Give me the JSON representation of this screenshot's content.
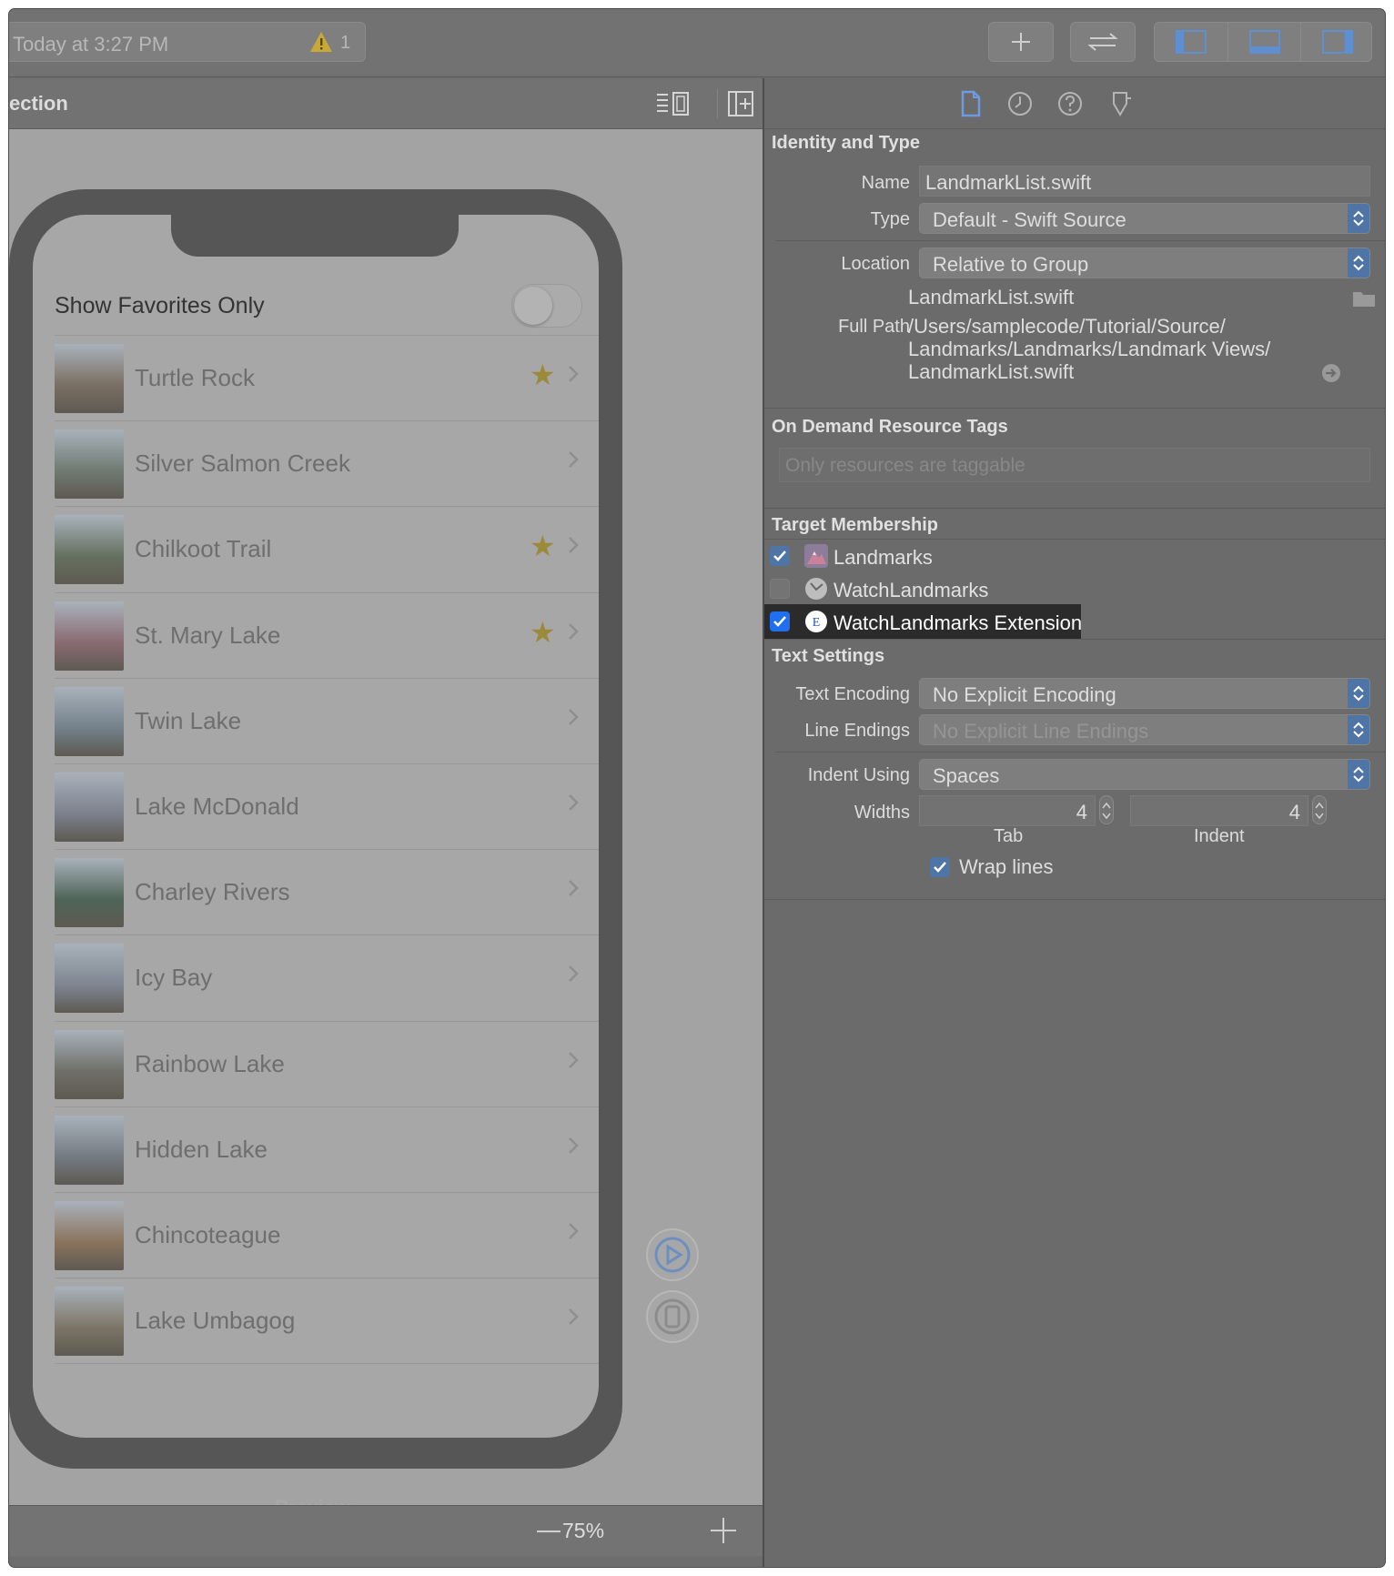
{
  "toolbar": {
    "status_text": "Today at 3:27 PM",
    "warning_count": "1",
    "icons": [
      "add-icon",
      "swap-icon",
      "navigator-panel-icon",
      "debug-panel-icon",
      "inspector-panel-icon"
    ]
  },
  "editor": {
    "title": "ection",
    "header_icons": [
      "editor-options-icon",
      "add-editor-icon"
    ]
  },
  "preview": {
    "favorites_label": "Show Favorites Only",
    "favorites_toggle": false,
    "landmarks": [
      {
        "name": "Turtle Rock",
        "favorite": true,
        "thumb_color": "#7a6f63"
      },
      {
        "name": "Silver Salmon Creek",
        "favorite": false,
        "thumb_color": "#6f7a72"
      },
      {
        "name": "Chilkoot Trail",
        "favorite": true,
        "thumb_color": "#65705f"
      },
      {
        "name": "St. Mary Lake",
        "favorite": true,
        "thumb_color": "#8a6a72"
      },
      {
        "name": "Twin Lake",
        "favorite": false,
        "thumb_color": "#73808a"
      },
      {
        "name": "Lake McDonald",
        "favorite": false,
        "thumb_color": "#7c808c"
      },
      {
        "name": "Charley Rivers",
        "favorite": false,
        "thumb_color": "#4f6458"
      },
      {
        "name": "Icy Bay",
        "favorite": false,
        "thumb_color": "#7e8590"
      },
      {
        "name": "Rainbow Lake",
        "favorite": false,
        "thumb_color": "#6e6f68"
      },
      {
        "name": "Hidden Lake",
        "favorite": false,
        "thumb_color": "#747a82"
      },
      {
        "name": "Chincoteague",
        "favorite": false,
        "thumb_color": "#8a735c"
      },
      {
        "name": "Lake Umbagog",
        "favorite": false,
        "thumb_color": "#7c7566"
      }
    ],
    "label": "Preview",
    "zoom": "75%"
  },
  "inspector": {
    "tabs": [
      "file-inspector-icon",
      "history-icon",
      "quick-help-icon",
      "accessibility-icon"
    ],
    "identity": {
      "title": "Identity and Type",
      "name_label": "Name",
      "name_value": "LandmarkList.swift",
      "type_label": "Type",
      "type_value": "Default - Swift Source",
      "location_label": "Location",
      "location_value": "Relative to Group",
      "file_name": "LandmarkList.swift",
      "full_path_label": "Full Path",
      "full_path_line1": "/Users/samplecode/Tutorial/Source/",
      "full_path_line2": "Landmarks/Landmarks/Landmark Views/",
      "full_path_line3": "LandmarkList.swift"
    },
    "odr": {
      "title": "On Demand Resource Tags",
      "placeholder": "Only resources are taggable"
    },
    "targets": {
      "title": "Target Membership",
      "items": [
        {
          "name": "Landmarks",
          "checked": true
        },
        {
          "name": "WatchLandmarks",
          "checked": false
        },
        {
          "name": "WatchLandmarks Extension",
          "checked": true
        }
      ]
    },
    "text_settings": {
      "title": "Text Settings",
      "encoding_label": "Text Encoding",
      "encoding_value": "No Explicit Encoding",
      "line_endings_label": "Line Endings",
      "line_endings_value": "No Explicit Line Endings",
      "indent_label": "Indent Using",
      "indent_value": "Spaces",
      "widths_label": "Widths",
      "tab_width": "4",
      "indent_width": "4",
      "tab_label": "Tab",
      "indent_sub_label": "Indent",
      "wrap_label": "Wrap lines",
      "wrap_checked": true
    }
  },
  "colors": {
    "accent": "#4f74a6",
    "selection_check": "#1f6ff0",
    "star": "#9c8a3c"
  }
}
